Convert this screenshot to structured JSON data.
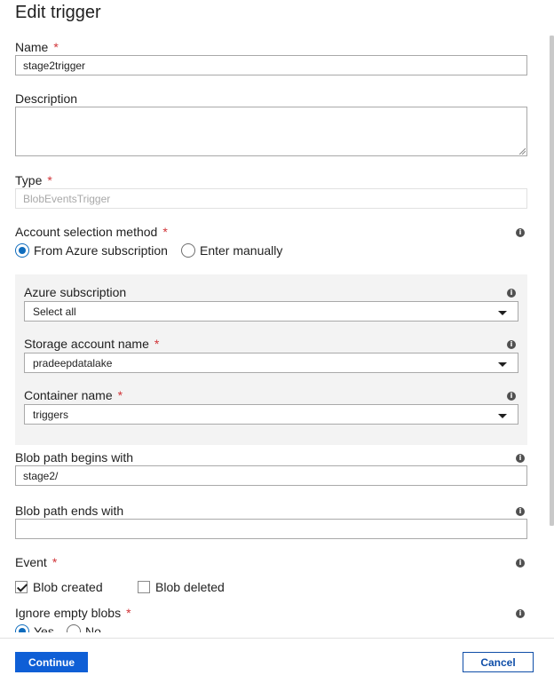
{
  "dialog": {
    "title": "Edit trigger"
  },
  "fields": {
    "name": {
      "label": "Name",
      "required": "*",
      "value": "stage2trigger"
    },
    "description": {
      "label": "Description",
      "value": ""
    },
    "type": {
      "label": "Type",
      "required": "*",
      "value": "BlobEventsTrigger"
    },
    "account_method": {
      "label": "Account selection method",
      "required": "*",
      "options": [
        "From Azure subscription",
        "Enter manually"
      ],
      "selected": "From Azure subscription"
    },
    "azure_subscription": {
      "label": "Azure subscription",
      "value": "Select all"
    },
    "storage_account": {
      "label": "Storage account name",
      "required": "*",
      "value": "pradeepdatalake"
    },
    "container": {
      "label": "Container name",
      "required": "*",
      "value": "triggers"
    },
    "blob_begins": {
      "label": "Blob path begins with",
      "value": "stage2/"
    },
    "blob_ends": {
      "label": "Blob path ends with",
      "value": ""
    },
    "event": {
      "label": "Event",
      "required": "*",
      "options": [
        {
          "label": "Blob created",
          "checked": true
        },
        {
          "label": "Blob deleted",
          "checked": false
        }
      ]
    },
    "ignore_empty": {
      "label": "Ignore empty blobs",
      "required": "*",
      "options": [
        "Yes",
        "No"
      ]
    }
  },
  "footer": {
    "continue_label": "Continue",
    "cancel_label": "Cancel"
  },
  "icons": {
    "info": "info-icon",
    "caret": "chevron-down-icon",
    "grip": "resize-grip-icon"
  },
  "colors": {
    "accent": "#0f6cbd",
    "primary_button": "#0f5fd6",
    "required": "#d13438"
  }
}
